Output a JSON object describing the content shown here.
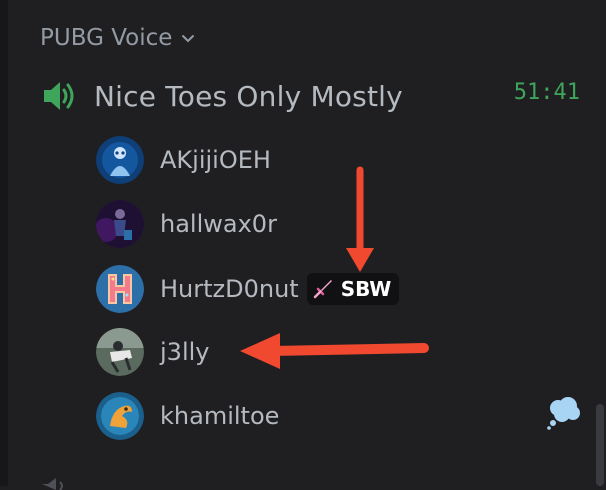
{
  "category": {
    "name": "PUBG Voice",
    "icon": "chevron-down-icon"
  },
  "channel": {
    "name": "Nice Toes Only Mostly",
    "icon": "speaker-icon",
    "timer": "51:41",
    "accent": "#3ea55a"
  },
  "users": [
    {
      "name": "AKjijiOEH"
    },
    {
      "name": "hallwax0r"
    },
    {
      "name": "HurtzD0nut",
      "tag": {
        "icon": "sword-icon",
        "text": "SBW"
      }
    },
    {
      "name": "j3lly"
    },
    {
      "name": "khamiltoe",
      "status_icon": "thought-bubble-icon"
    }
  ],
  "annotation_color": "#f0492f"
}
